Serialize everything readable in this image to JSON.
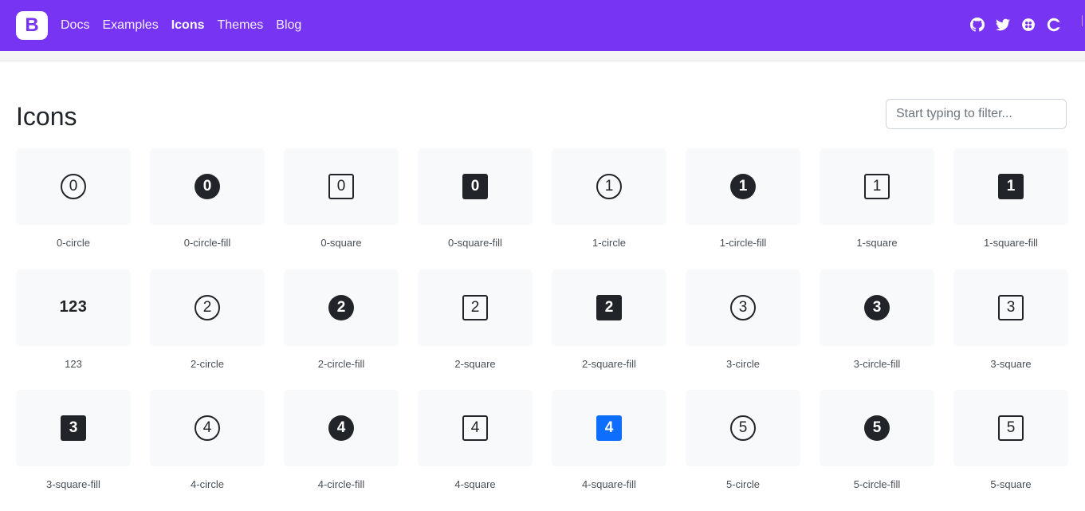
{
  "nav": {
    "brand": "B",
    "links": [
      {
        "label": "Docs",
        "active": false
      },
      {
        "label": "Examples",
        "active": false
      },
      {
        "label": "Icons",
        "active": true
      },
      {
        "label": "Themes",
        "active": false
      },
      {
        "label": "Blog",
        "active": false
      }
    ],
    "icons": [
      "github-icon",
      "twitter-icon",
      "opencollective-icon",
      "menu-icon"
    ]
  },
  "page": {
    "title": "Icons",
    "filter_placeholder": "Start typing to filter..."
  },
  "colors": {
    "navbar": "#7834f3",
    "tile_bg": "#f8f9fa",
    "glyph": "#212529",
    "highlight": "#0d6efd"
  },
  "icons": [
    {
      "name": "0-circle",
      "glyph": "0",
      "style": "circle"
    },
    {
      "name": "0-circle-fill",
      "glyph": "0",
      "style": "circle-fill"
    },
    {
      "name": "0-square",
      "glyph": "0",
      "style": "square"
    },
    {
      "name": "0-square-fill",
      "glyph": "0",
      "style": "square-fill"
    },
    {
      "name": "1-circle",
      "glyph": "1",
      "style": "circle"
    },
    {
      "name": "1-circle-fill",
      "glyph": "1",
      "style": "circle-fill"
    },
    {
      "name": "1-square",
      "glyph": "1",
      "style": "square"
    },
    {
      "name": "1-square-fill",
      "glyph": "1",
      "style": "square-fill"
    },
    {
      "name": "123",
      "glyph": "123",
      "style": "text"
    },
    {
      "name": "2-circle",
      "glyph": "2",
      "style": "circle"
    },
    {
      "name": "2-circle-fill",
      "glyph": "2",
      "style": "circle-fill"
    },
    {
      "name": "2-square",
      "glyph": "2",
      "style": "square"
    },
    {
      "name": "2-square-fill",
      "glyph": "2",
      "style": "square-fill"
    },
    {
      "name": "3-circle",
      "glyph": "3",
      "style": "circle"
    },
    {
      "name": "3-circle-fill",
      "glyph": "3",
      "style": "circle-fill"
    },
    {
      "name": "3-square",
      "glyph": "3",
      "style": "square"
    },
    {
      "name": "3-square-fill",
      "glyph": "3",
      "style": "square-fill"
    },
    {
      "name": "4-circle",
      "glyph": "4",
      "style": "circle"
    },
    {
      "name": "4-circle-fill",
      "glyph": "4",
      "style": "circle-fill"
    },
    {
      "name": "4-square",
      "glyph": "4",
      "style": "square"
    },
    {
      "name": "4-square-fill",
      "glyph": "4",
      "style": "square-fill",
      "highlight": true
    },
    {
      "name": "5-circle",
      "glyph": "5",
      "style": "circle"
    },
    {
      "name": "5-circle-fill",
      "glyph": "5",
      "style": "circle-fill"
    },
    {
      "name": "5-square",
      "glyph": "5",
      "style": "square"
    }
  ]
}
